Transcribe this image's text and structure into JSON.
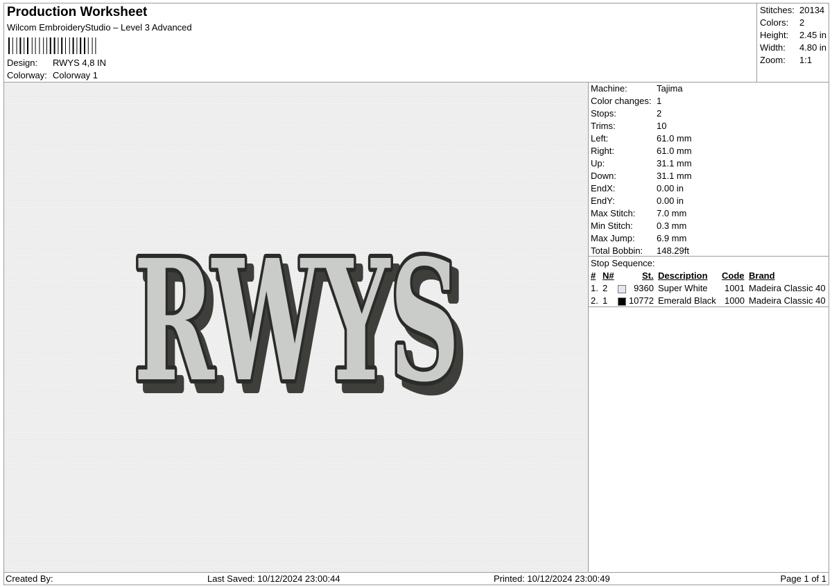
{
  "header": {
    "title": "Production Worksheet",
    "subtitle": "Wilcom EmbroideryStudio – Level 3 Advanced",
    "design_label": "Design:",
    "design_value": "RWYS 4,8 IN",
    "colorway_label": "Colorway:",
    "colorway_value": "Colorway 1"
  },
  "summary": [
    {
      "label": "Stitches:",
      "value": "20134"
    },
    {
      "label": "Colors:",
      "value": "2"
    },
    {
      "label": "Height:",
      "value": "2.45 in"
    },
    {
      "label": "Width:",
      "value": "4.80 in"
    },
    {
      "label": "Zoom:",
      "value": "1:1"
    }
  ],
  "preview": {
    "design_text": "RWYS",
    "fill_color": "#c9ccc9",
    "outline_color": "#2b2c29",
    "shadow_color": "#3e3f3b"
  },
  "details": [
    {
      "label": "Machine:",
      "value": "Tajima"
    },
    {
      "label": "Color changes:",
      "value": "1"
    },
    {
      "label": "Stops:",
      "value": "2"
    },
    {
      "label": "Trims:",
      "value": "10"
    },
    {
      "label": "Left:",
      "value": "61.0 mm"
    },
    {
      "label": "Right:",
      "value": "61.0 mm"
    },
    {
      "label": "Up:",
      "value": "31.1 mm"
    },
    {
      "label": "Down:",
      "value": "31.1 mm"
    },
    {
      "label": "EndX:",
      "value": "0.00 in"
    },
    {
      "label": "EndY:",
      "value": "0.00 in"
    },
    {
      "label": "Max Stitch:",
      "value": "7.0 mm"
    },
    {
      "label": "Min Stitch:",
      "value": "0.3 mm"
    },
    {
      "label": "Max Jump:",
      "value": "6.9 mm"
    },
    {
      "label": "Total Bobbin:",
      "value": "148.29ft"
    }
  ],
  "stop_sequence": {
    "title": "Stop Sequence:",
    "headers": {
      "num": "#",
      "n": "N#",
      "st": "St.",
      "description": "Description",
      "code": "Code",
      "brand": "Brand"
    },
    "rows": [
      {
        "num": "1.",
        "n": "2",
        "color": "#e6e6f0",
        "st": "9360",
        "description": "Super White",
        "code": "1001",
        "brand": "Madeira Classic 40"
      },
      {
        "num": "2.",
        "n": "1",
        "color": "#000000",
        "st": "10772",
        "description": "Emerald Black",
        "code": "1000",
        "brand": "Madeira Classic 40"
      }
    ]
  },
  "footer": {
    "created_by": "Created By:",
    "last_saved": "Last Saved: 10/12/2024 23:00:44",
    "printed": "Printed: 10/12/2024 23:00:49",
    "page": "Page 1 of 1"
  }
}
